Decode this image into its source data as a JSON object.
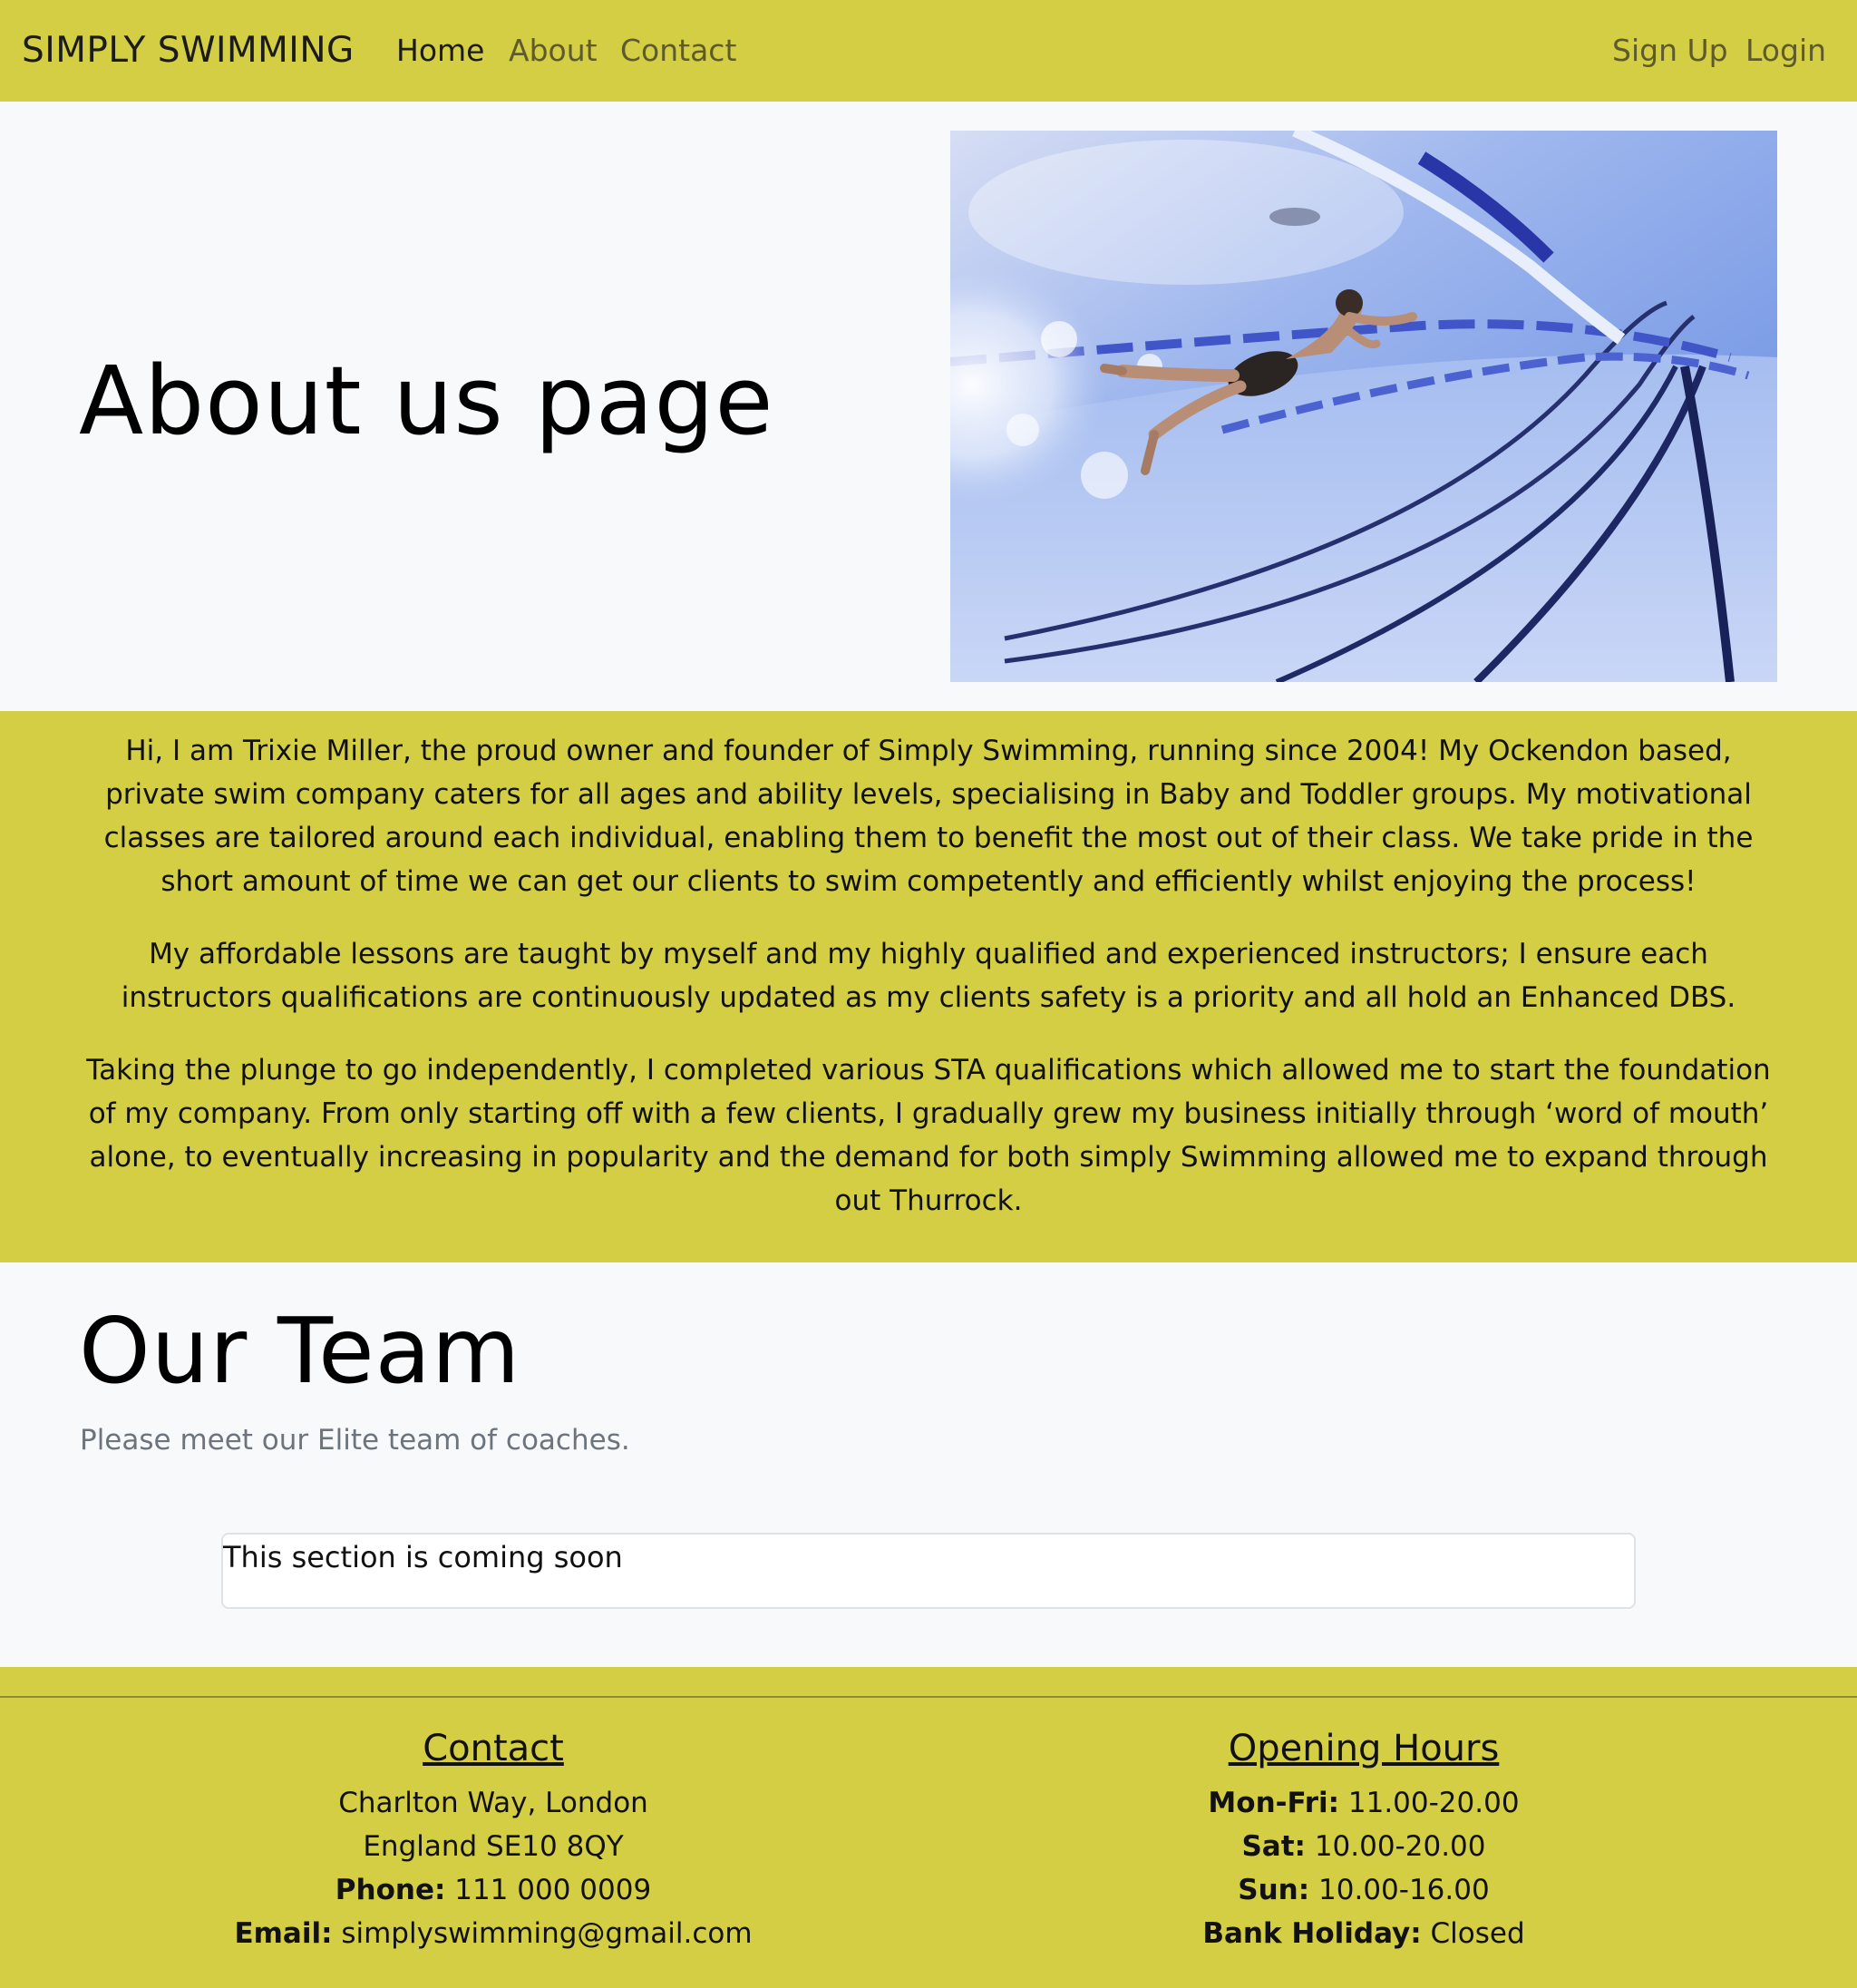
{
  "navbar": {
    "brand": "SIMPLY SWIMMING",
    "links": [
      "Home",
      "About",
      "Contact"
    ],
    "auth": [
      "Sign Up",
      "Login"
    ]
  },
  "hero": {
    "title": "About us page"
  },
  "about": {
    "paragraphs": [
      "Hi, I am Trixie Miller, the proud owner and founder of Simply Swimming, running since 2004! My Ockendon based, private swim company caters for all ages and ability levels, specialising in Baby and Toddler groups. My motivational classes are tailored around each individual, enabling them to benefit the most out of their class. We take pride in the short amount of time we can get our clients to swim competently and efficiently whilst enjoying the process!",
      "My affordable lessons are taught by myself and my highly qualified and experienced instructors; I ensure each instructors qualifications are continuously updated as my clients safety is a priority and all hold an Enhanced DBS.",
      "Taking the plunge to go independently, I completed various STA qualifications which allowed me to start the foundation of my company. From only starting off with a few clients, I gradually grew my business initially through ‘word of mouth’ alone, to eventually increasing in popularity and the demand for both simply Swimming allowed me to expand through out Thurrock."
    ]
  },
  "team": {
    "title": "Our Team",
    "lead": "Please meet our Elite team of coaches.",
    "coming_soon": "This section is coming soon"
  },
  "footer": {
    "contact": {
      "heading": "Contact",
      "address_line1": "Charlton Way, London",
      "address_line2": "England SE10 8QY",
      "phone_label": "Phone:",
      "phone": "111 000 0009",
      "email_label": "Email:",
      "email": "simplyswimming@gmail.com"
    },
    "hours": {
      "heading": "Opening Hours",
      "rows": [
        {
          "label": "Mon-Fri:",
          "value": "11.00-20.00"
        },
        {
          "label": "Sat:",
          "value": "10.00-20.00"
        },
        {
          "label": "Sun:",
          "value": "10.00-16.00"
        },
        {
          "label": "Bank Holiday:",
          "value": "Closed"
        }
      ]
    }
  },
  "colors": {
    "brand_yellow": "#d4ce44",
    "page_background": "#f8f9fa",
    "muted_text": "#6c757d"
  }
}
